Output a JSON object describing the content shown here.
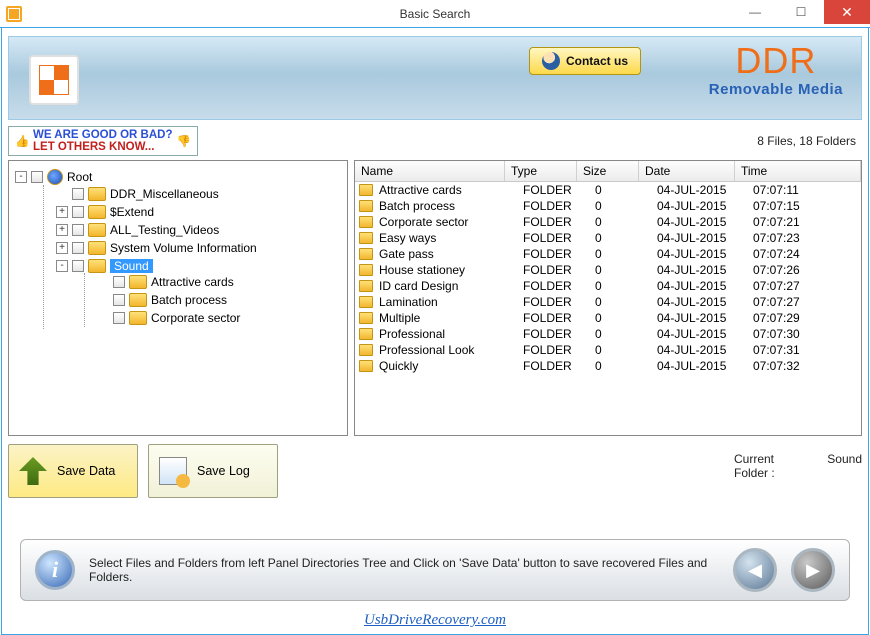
{
  "window": {
    "title": "Basic Search"
  },
  "banner": {
    "contact_label": "Contact us",
    "brand": "DDR",
    "brand_sub": "Removable Media"
  },
  "feedback": {
    "line1": "WE ARE GOOD OR BAD?",
    "line2": "LET OTHERS KNOW..."
  },
  "counts_text": "8 Files, 18 Folders",
  "tree": {
    "root_label": "Root",
    "items": [
      {
        "label": "DDR_Miscellaneous",
        "expander": ""
      },
      {
        "label": "$Extend",
        "expander": "+"
      },
      {
        "label": "ALL_Testing_Videos",
        "expander": "+"
      },
      {
        "label": "System Volume Information",
        "expander": "+"
      },
      {
        "label": "Sound",
        "expander": "-",
        "selected": true,
        "children": [
          {
            "label": "Attractive cards"
          },
          {
            "label": "Batch process"
          },
          {
            "label": "Corporate sector"
          }
        ]
      }
    ]
  },
  "buttons": {
    "save_data": "Save Data",
    "save_log": "Save Log"
  },
  "columns": {
    "name": "Name",
    "type": "Type",
    "size": "Size",
    "date": "Date",
    "time": "Time"
  },
  "files": [
    {
      "name": "Attractive cards",
      "type": "FOLDER",
      "size": "0",
      "date": "04-JUL-2015",
      "time": "07:07:11"
    },
    {
      "name": "Batch process",
      "type": "FOLDER",
      "size": "0",
      "date": "04-JUL-2015",
      "time": "07:07:15"
    },
    {
      "name": "Corporate sector",
      "type": "FOLDER",
      "size": "0",
      "date": "04-JUL-2015",
      "time": "07:07:21"
    },
    {
      "name": "Easy ways",
      "type": "FOLDER",
      "size": "0",
      "date": "04-JUL-2015",
      "time": "07:07:23"
    },
    {
      "name": "Gate pass",
      "type": "FOLDER",
      "size": "0",
      "date": "04-JUL-2015",
      "time": "07:07:24"
    },
    {
      "name": "House stationey",
      "type": "FOLDER",
      "size": "0",
      "date": "04-JUL-2015",
      "time": "07:07:26"
    },
    {
      "name": "ID card Design",
      "type": "FOLDER",
      "size": "0",
      "date": "04-JUL-2015",
      "time": "07:07:27"
    },
    {
      "name": "Lamination",
      "type": "FOLDER",
      "size": "0",
      "date": "04-JUL-2015",
      "time": "07:07:27"
    },
    {
      "name": "Multiple",
      "type": "FOLDER",
      "size": "0",
      "date": "04-JUL-2015",
      "time": "07:07:29"
    },
    {
      "name": "Professional",
      "type": "FOLDER",
      "size": "0",
      "date": "04-JUL-2015",
      "time": "07:07:30"
    },
    {
      "name": "Professional Look",
      "type": "FOLDER",
      "size": "0",
      "date": "04-JUL-2015",
      "time": "07:07:31"
    },
    {
      "name": "Quickly",
      "type": "FOLDER",
      "size": "0",
      "date": "04-JUL-2015",
      "time": "07:07:32"
    }
  ],
  "current_folder_label": "Current Folder :",
  "current_folder_value": "Sound",
  "info_text": "Select Files and Folders from left Panel Directories Tree and Click on 'Save Data' button to save recovered Files and Folders.",
  "footer_link": "UsbDriveRecovery.com"
}
